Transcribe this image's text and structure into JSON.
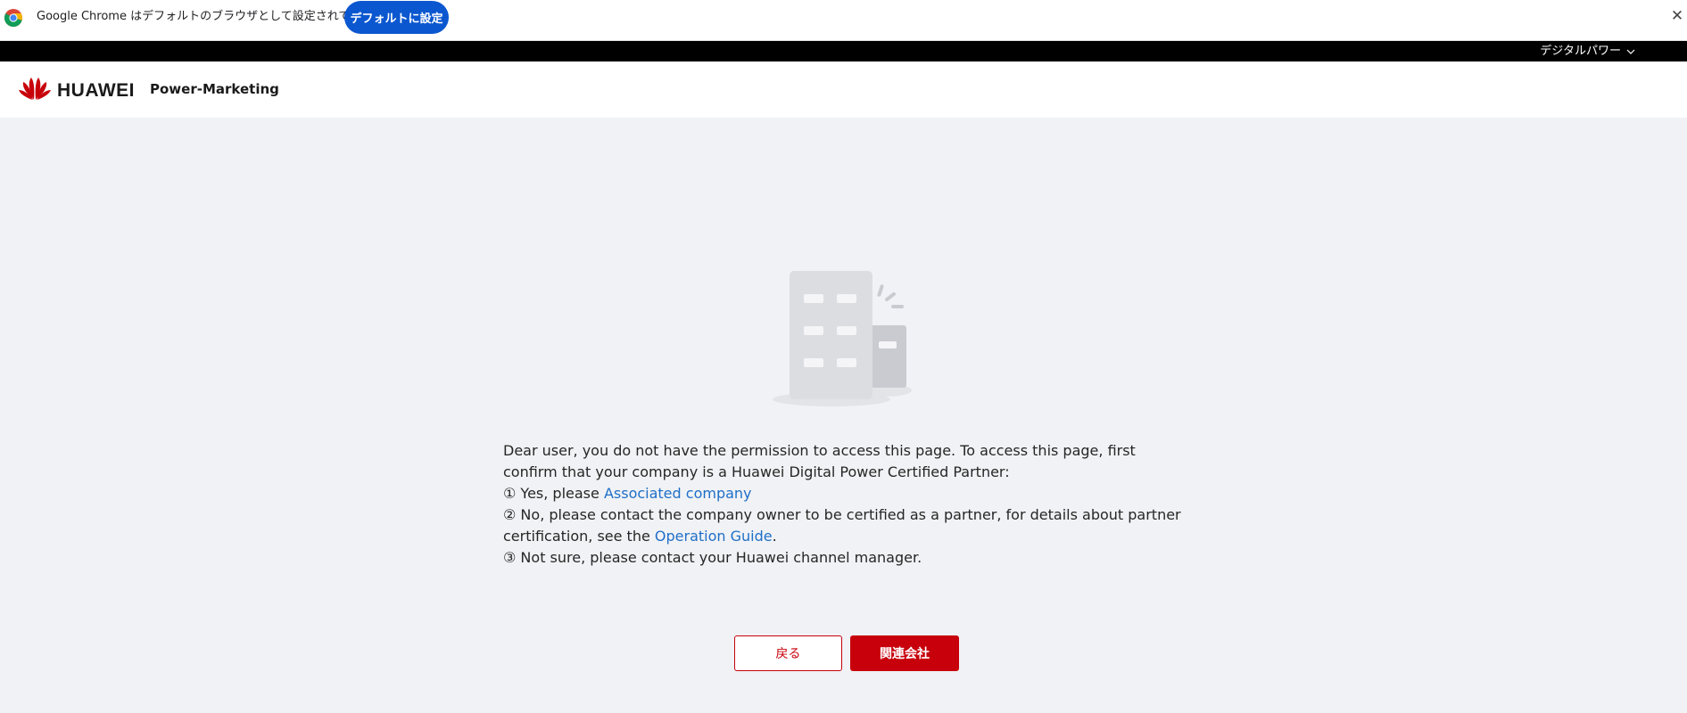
{
  "browser_notice": {
    "message": "Google Chrome はデフォルトのブラウザとして設定されていません",
    "set_default_label": "デフォルトに設定",
    "close_label": "✕"
  },
  "topbar": {
    "menu_label": "デジタルパワー"
  },
  "header": {
    "logo_text": "HUAWEI",
    "product_name": "Power-Marketing"
  },
  "message": {
    "intro": "Dear user, you do not have the permission to access this page. To access this page, first confirm that your company is a Huawei Digital Power Certified Partner:",
    "option1_prefix": "① Yes, please ",
    "option1_link": "Associated company",
    "option2_prefix": "② No, please contact the company owner to be certified as a partner, for details about partner certification, see the ",
    "option2_link": "Operation Guide",
    "option2_suffix": ".",
    "option3": "③ Not sure, please contact your Huawei channel manager."
  },
  "actions": {
    "back_label": "戻る",
    "associate_label": "関連会社"
  },
  "colors": {
    "brand_red": "#c7000b",
    "link_blue": "#1e6fc8",
    "chrome_blue": "#0b57d0",
    "page_bg": "#f1f2f5"
  }
}
